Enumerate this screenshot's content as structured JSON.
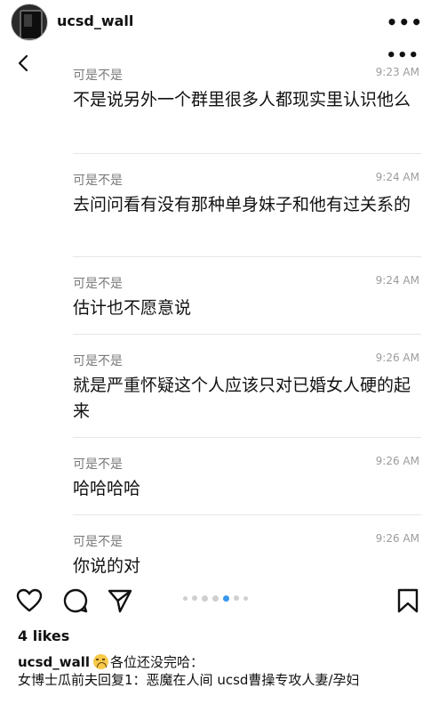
{
  "header": {
    "username": "ucsd_wall",
    "more_label": "•••"
  },
  "post": {
    "more_label": "•••",
    "messages": [
      {
        "sender": "可是不是",
        "time": "9:23 AM",
        "text": "不是说另外一个群里很多人都现实里认识他么"
      },
      {
        "sender": "可是不是",
        "time": "9:24 AM",
        "text": "去问问看有没有那种单身妹子和他有过关系的"
      },
      {
        "sender": "可是不是",
        "time": "9:24 AM",
        "text": "估计也不愿意说"
      },
      {
        "sender": "可是不是",
        "time": "9:26 AM",
        "text": "就是严重怀疑这个人应该只对已婚女人硬的起来"
      },
      {
        "sender": "可是不是",
        "time": "9:26 AM",
        "text": "哈哈哈哈"
      },
      {
        "sender": "可是不是",
        "time": "9:26 AM",
        "text": "你说的对"
      }
    ]
  },
  "carousel": {
    "total": 7,
    "active_index": 4
  },
  "likes": "4 likes",
  "caption": {
    "username": "ucsd_wall",
    "emoji": "worried-face",
    "line1": "各位还没完哈：",
    "line2": "女博士瓜前夫回复1：恶魔在人间 ucsd曹操专攻人妻/孕妇"
  },
  "colors": {
    "background": "#ffffff",
    "text": "#111111",
    "muted": "#7a7a7a",
    "active_dot": "#3897f0"
  }
}
